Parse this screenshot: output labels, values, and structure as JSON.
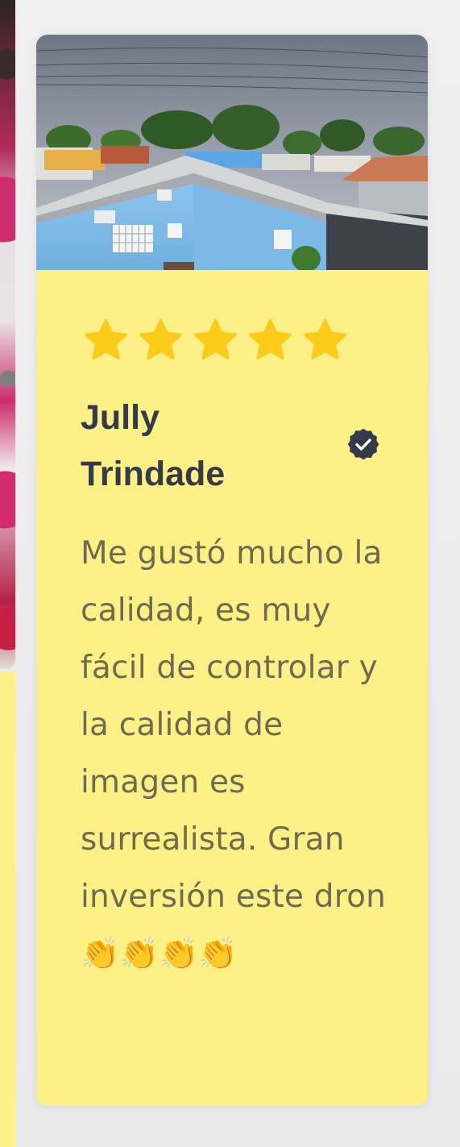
{
  "review": {
    "rating": 5,
    "rating_max": 5,
    "author": "Jully Trindade",
    "verified": true,
    "text": "Me gustó mucho la calidad, es muy fácil de controlar y la calidad de imagen es surrealista. Gran inversión este dron 👏👏👏👏"
  },
  "icons": {
    "star": "star-icon",
    "verified": "verified-badge-icon"
  },
  "colors": {
    "card_background": "#fdf087",
    "star": "#fbcb19",
    "author": "#333b4a",
    "review_text": "#6f6b4e",
    "verified_badge": "#333b4a"
  }
}
